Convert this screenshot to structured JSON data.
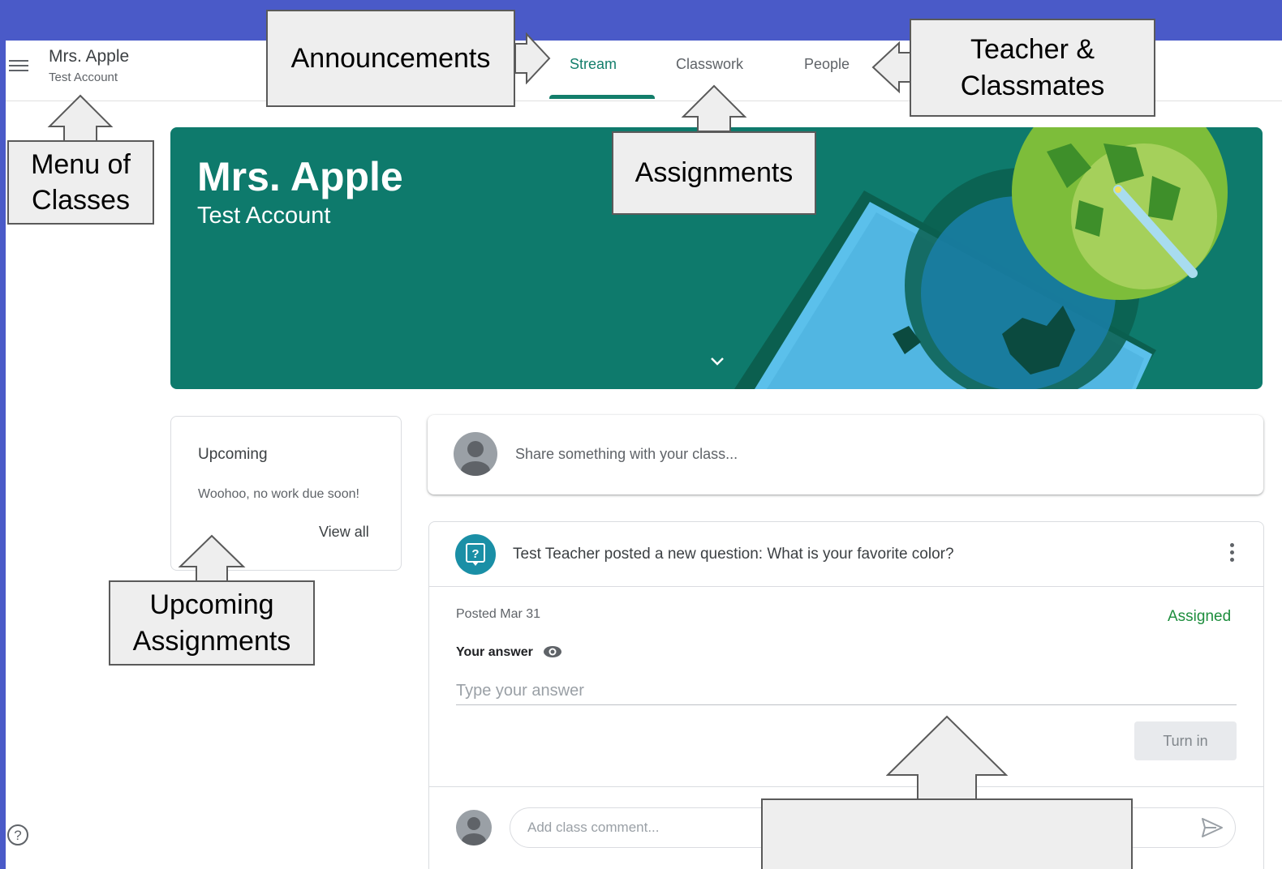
{
  "header": {
    "class_name": "Mrs. Apple",
    "class_section": "Test Account",
    "tabs": [
      {
        "label": "Stream",
        "active": true
      },
      {
        "label": "Classwork",
        "active": false
      },
      {
        "label": "People",
        "active": false
      }
    ]
  },
  "banner": {
    "title": "Mrs. Apple",
    "subtitle": "Test Account",
    "color": "#0e7a6c"
  },
  "upcoming": {
    "title": "Upcoming",
    "message": "Woohoo, no work due soon!",
    "view_all_label": "View all"
  },
  "share": {
    "placeholder": "Share something with your class..."
  },
  "post": {
    "title": "Test Teacher posted a new question: What is your favorite color?",
    "posted": "Posted Mar 31",
    "status": "Assigned",
    "your_answer_label": "Your answer",
    "answer_placeholder": "Type your answer",
    "turn_in_label": "Turn in",
    "comment_placeholder": "Add class comment..."
  },
  "callouts": {
    "announcements": "Announcements",
    "teacher_classmates": "Teacher &\nClassmates",
    "menu_of_classes": "Menu of\nClasses",
    "assignments": "Assignments",
    "upcoming_assignments": "Upcoming\nAssignments",
    "blank": ""
  },
  "colors": {
    "accent": "#137e6b",
    "slide_background": "#4a5ac8",
    "assigned_status": "#1e8e3e"
  },
  "icons": [
    "menu-icon",
    "chevron-down-icon",
    "question-icon",
    "more-vert-icon",
    "eye-icon",
    "send-icon",
    "help-icon",
    "avatar-icon"
  ]
}
